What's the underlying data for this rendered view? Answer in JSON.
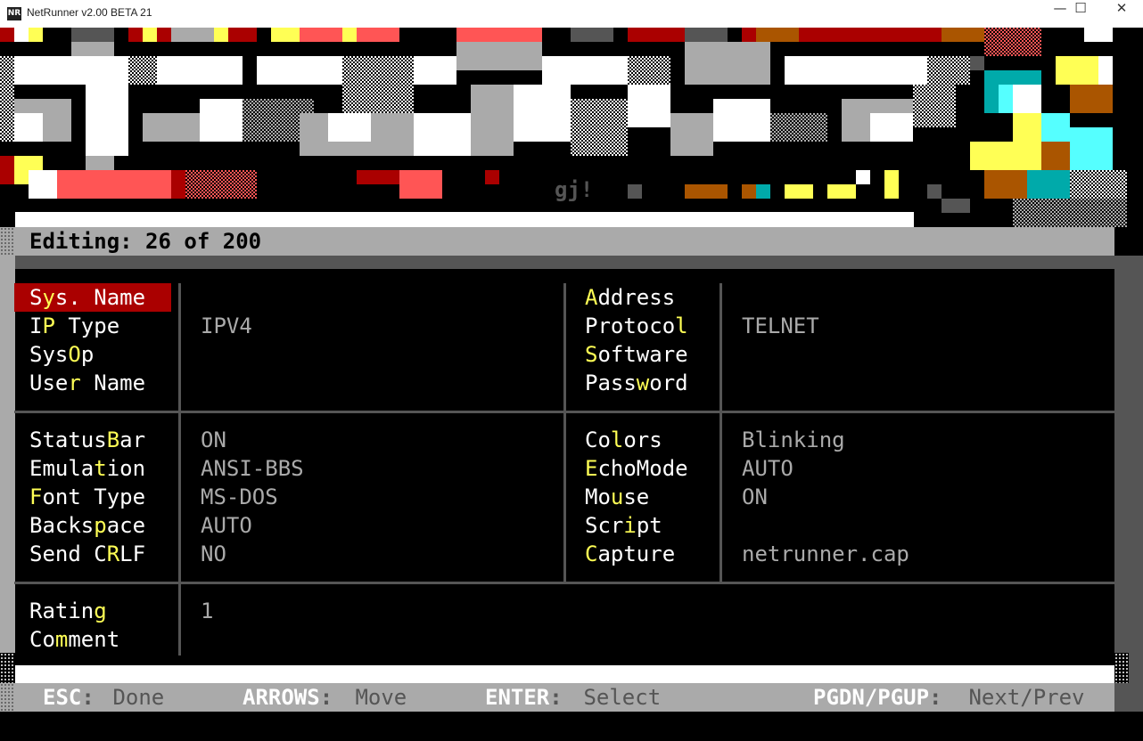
{
  "window": {
    "app_icon_text": "NR",
    "title": "NetRunner v2.00 BETA 21",
    "minimize_glyph": "—",
    "maximize_glyph": "☐",
    "close_glyph": "✕"
  },
  "banner": {
    "signature": "gj!"
  },
  "editing": {
    "label": "Editing: 26 of 200"
  },
  "fields": {
    "sys_name": {
      "pre": "S",
      "hk": "y",
      "post": "s. Name",
      "value": ""
    },
    "ip_type": {
      "pre": "I",
      "hk": "P",
      "post": " Type",
      "value": "IPV4"
    },
    "sysop": {
      "pre": "Sys",
      "hk": "O",
      "post": "p",
      "value": ""
    },
    "user_name": {
      "pre": "Use",
      "hk": "r",
      "post": " Name",
      "value": ""
    },
    "address": {
      "pre": "",
      "hk": "A",
      "post": "ddress",
      "value": ""
    },
    "protocol": {
      "pre": "Protoco",
      "hk": "l",
      "post": "",
      "value": "TELNET"
    },
    "software": {
      "pre": "",
      "hk": "S",
      "post": "oftware",
      "value": ""
    },
    "password": {
      "pre": "Pass",
      "hk": "w",
      "post": "ord",
      "value": ""
    },
    "statusbar": {
      "pre": "Status",
      "hk": "B",
      "post": "ar",
      "value": "ON"
    },
    "emulation": {
      "pre": "Emula",
      "hk": "t",
      "post": "ion",
      "value": "ANSI-BBS"
    },
    "font_type": {
      "pre": "",
      "hk": "F",
      "post": "ont Type",
      "value": "MS-DOS"
    },
    "backspace": {
      "pre": "Backs",
      "hk": "p",
      "post": "ace",
      "value": "AUTO"
    },
    "send_crlf": {
      "pre": "Send C",
      "hk": "R",
      "post": "LF",
      "value": "NO"
    },
    "colors": {
      "pre": "Co",
      "hk": "l",
      "post": "ors",
      "value": "Blinking"
    },
    "echomode": {
      "pre": "",
      "hk": "E",
      "post": "choMode",
      "value": "AUTO"
    },
    "mouse": {
      "pre": "Mo",
      "hk": "u",
      "post": "se",
      "value": "ON"
    },
    "script": {
      "pre": "Scr",
      "hk": "i",
      "post": "pt",
      "value": ""
    },
    "capture": {
      "pre": "",
      "hk": "C",
      "post": "apture",
      "value": "netrunner.cap"
    },
    "rating": {
      "pre": "Ratin",
      "hk": "g",
      "post": "",
      "value": "1"
    },
    "comment": {
      "pre": "Co",
      "hk": "m",
      "post": "ment",
      "value": ""
    }
  },
  "footer": {
    "esc_key": "ESC",
    "esc_sep": ":",
    "esc_action": " Done",
    "arrows_key": "ARROWS",
    "arrows_sep": ":",
    "arrows_action": " Move",
    "enter_key": "ENTER",
    "enter_sep": ":",
    "enter_action": " Select",
    "pg_key": "PGDN/PGUP",
    "pg_sep": ":",
    "pg_action": " Next/Prev"
  },
  "colors": {
    "highlight": "#aa0000",
    "hotkey": "#ffff55",
    "label": "#ffffff",
    "value": "#aaaaaa",
    "frame": "#555555"
  }
}
